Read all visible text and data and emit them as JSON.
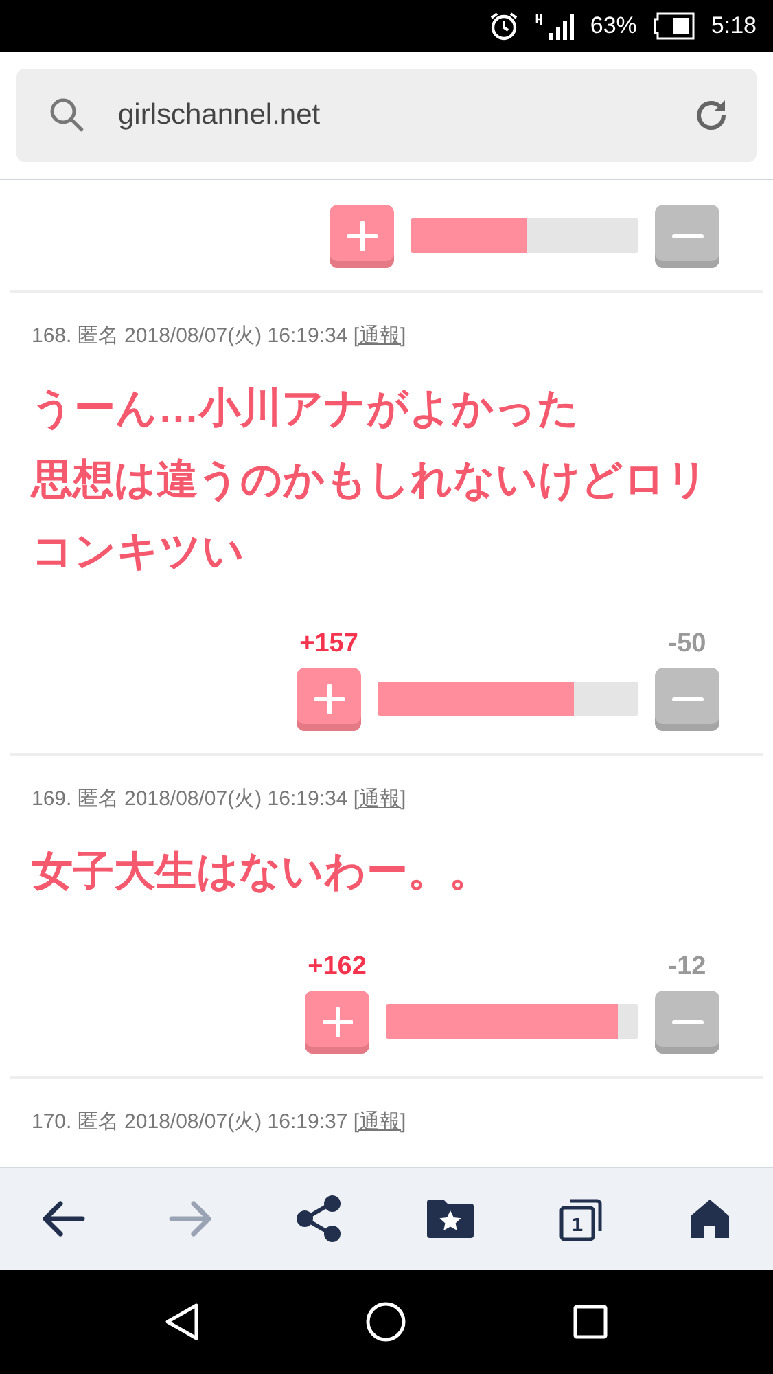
{
  "status_bar": {
    "battery": "63%",
    "time": "5:18"
  },
  "address_bar": {
    "url": "girlschannel.net"
  },
  "top_vote": {
    "level": 0.51
  },
  "comments": [
    {
      "number": "168.",
      "author": "匿名",
      "date": "2018/08/07(火) 16:19:34",
      "report": "[通報]",
      "lines": [
        "うーん…小川アナがよかった",
        "思想は違うのかもしれないけどロリコンキツい"
      ],
      "plus": "+157",
      "minus": "-50",
      "level": 0.75
    },
    {
      "number": "169.",
      "author": "匿名",
      "date": "2018/08/07(火) 16:19:34",
      "report": "[通報]",
      "lines": [
        "女子大生はないわー。。"
      ],
      "plus": "+162",
      "minus": "-12",
      "level": 0.92
    },
    {
      "number": "170.",
      "author": "匿名",
      "date": "2018/08/07(火) 16:19:37",
      "report": "[通報]"
    }
  ],
  "bottom_nav": [
    {
      "kind": "back",
      "disabled": false
    },
    {
      "kind": "forward",
      "disabled": true
    },
    {
      "kind": "share",
      "disabled": false
    },
    {
      "kind": "bookmarks",
      "disabled": false
    },
    {
      "kind": "tabs",
      "disabled": false,
      "count": "1"
    },
    {
      "kind": "home",
      "disabled": false
    }
  ]
}
